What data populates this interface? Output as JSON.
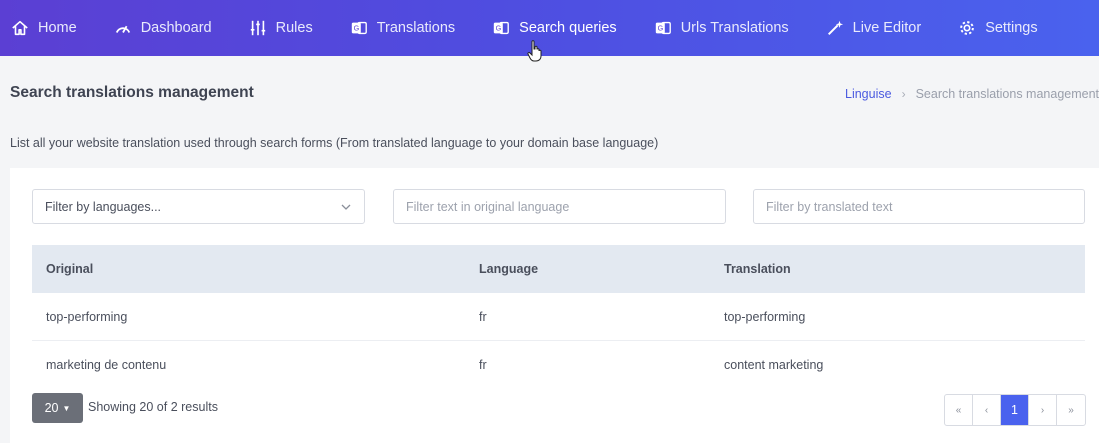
{
  "nav": {
    "items": [
      {
        "label": "Home",
        "icon": "home-icon"
      },
      {
        "label": "Dashboard",
        "icon": "speedometer-icon"
      },
      {
        "label": "Rules",
        "icon": "sliders-icon"
      },
      {
        "label": "Translations",
        "icon": "translate-icon"
      },
      {
        "label": "Search queries",
        "icon": "translate-icon",
        "active": true
      },
      {
        "label": "Urls Translations",
        "icon": "translate-icon"
      },
      {
        "label": "Live Editor",
        "icon": "magic-wand-icon"
      },
      {
        "label": "Settings",
        "icon": "gear-icon"
      }
    ],
    "gradient": [
      "#5b3fd3",
      "#4a62ee"
    ]
  },
  "page": {
    "title": "Search translations management",
    "description": "List all your website translation used through search forms (From translated language to your domain base language)"
  },
  "breadcrumb": {
    "root": "Linguise",
    "separator": "›",
    "current": "Search translations management"
  },
  "filters": {
    "languages_placeholder": "Filter by languages...",
    "original_placeholder": "Filter text in original language",
    "translated_placeholder": "Filter by translated text"
  },
  "table": {
    "headers": [
      "Original",
      "Language",
      "Translation"
    ],
    "rows": [
      {
        "original": "top-performing",
        "language": "fr",
        "translation": "top-performing"
      },
      {
        "original": "marketing de contenu",
        "language": "fr",
        "translation": "content marketing"
      }
    ]
  },
  "footer": {
    "page_size": "20",
    "showing": "Showing 20 of 2 results"
  },
  "pagination": {
    "first": "«",
    "prev": "‹",
    "current": "1",
    "next": "›",
    "last": "»"
  },
  "colors": {
    "accent": "#4a62ee",
    "header_bg": "#e3e9f1"
  }
}
